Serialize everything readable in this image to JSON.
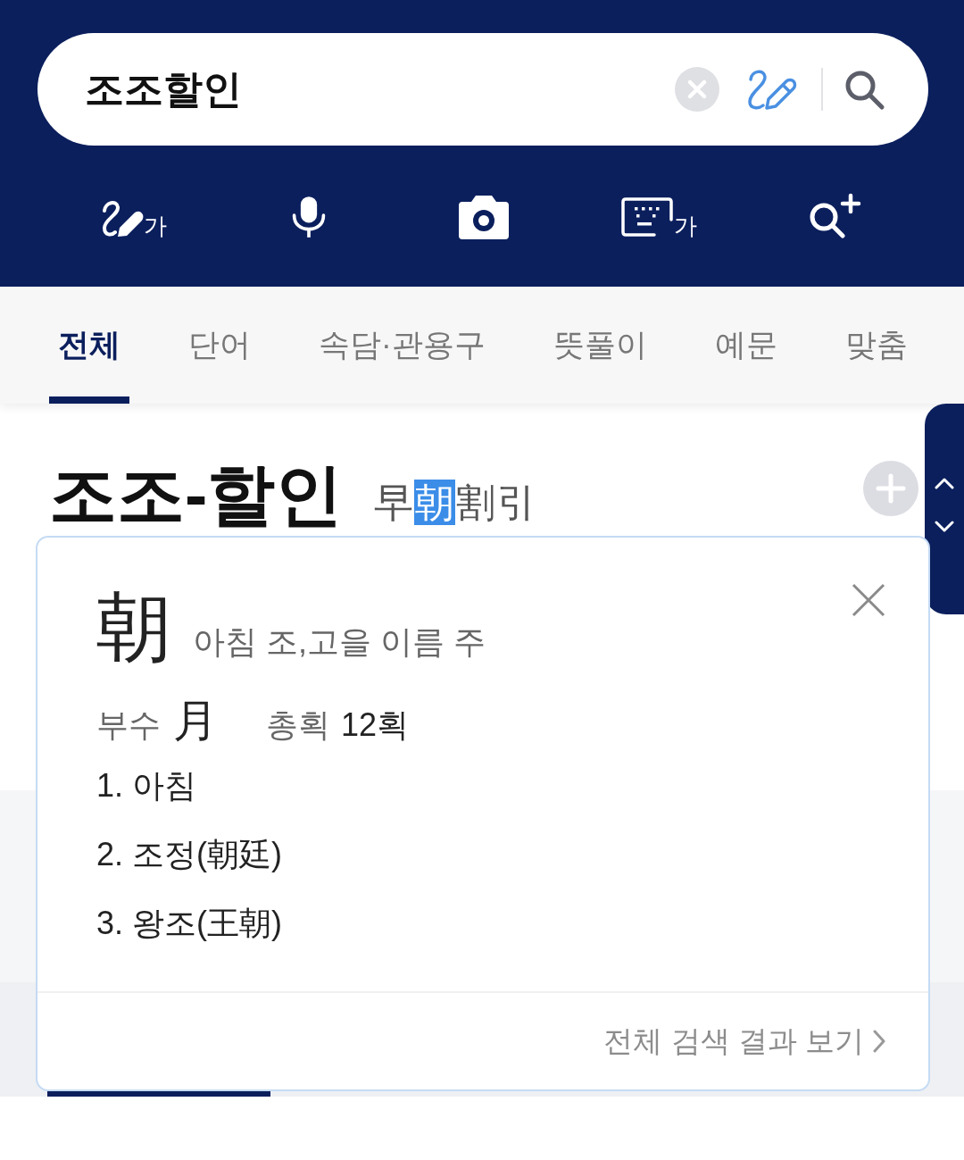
{
  "search": {
    "query": "조조할인"
  },
  "input_tools": [
    {
      "kind": "handwriting",
      "label": "가"
    },
    {
      "kind": "voice"
    },
    {
      "kind": "camera"
    },
    {
      "kind": "keyboard",
      "label": "가"
    },
    {
      "kind": "zoom"
    }
  ],
  "tabs": [
    {
      "label": "전체",
      "selected": true
    },
    {
      "label": "단어",
      "selected": false
    },
    {
      "label": "속담·관용구",
      "selected": false
    },
    {
      "label": "뜻풀이",
      "selected": false
    },
    {
      "label": "예문",
      "selected": false
    },
    {
      "label": "맞춤",
      "selected": false
    }
  ],
  "entry": {
    "headword": "조조-할인",
    "hanja": [
      {
        "char": "早",
        "selected": false
      },
      {
        "char": "朝",
        "selected": true
      },
      {
        "char": "割",
        "selected": false
      },
      {
        "char": "引",
        "selected": false
      }
    ]
  },
  "hanja_popup": {
    "character": "朝",
    "readings": "아침 조,고을 이름 주",
    "radical_label": "부수",
    "radical": "月",
    "strokes_label": "총획",
    "strokes": "12획",
    "meanings": [
      "1. 아침",
      "2. 조정(朝廷)",
      "3. 왕조(王朝)"
    ],
    "footer_link": "전체 검색 결과 보기"
  }
}
